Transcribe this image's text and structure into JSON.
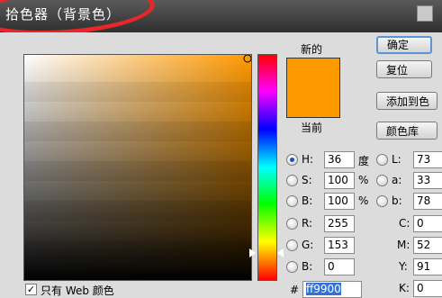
{
  "title": "拾色器（背景色）",
  "labels": {
    "new": "新的",
    "current": "当前"
  },
  "buttons": {
    "ok": "确定",
    "reset": "复位",
    "add_to_swatches": "添加到色",
    "color_libraries": "颜色库"
  },
  "hsb": {
    "h": {
      "label": "H:",
      "value": "36",
      "unit": "度"
    },
    "s": {
      "label": "S:",
      "value": "100",
      "unit": "%"
    },
    "b": {
      "label": "B:",
      "value": "100",
      "unit": "%"
    }
  },
  "rgb": {
    "r": {
      "label": "R:",
      "value": "255"
    },
    "g": {
      "label": "G:",
      "value": "153"
    },
    "b": {
      "label": "B:",
      "value": "0"
    }
  },
  "lab": {
    "l": {
      "label": "L:",
      "value": "73"
    },
    "a": {
      "label": "a:",
      "value": "33"
    },
    "b": {
      "label": "b:",
      "value": "78"
    }
  },
  "cmyk": {
    "c": {
      "label": "C:",
      "value": "0"
    },
    "m": {
      "label": "M:",
      "value": "52"
    },
    "y": {
      "label": "Y:",
      "value": "91"
    },
    "k": {
      "label": "K:",
      "value": "0"
    }
  },
  "hex": {
    "label": "#",
    "value": "ff9900"
  },
  "web_only": {
    "label": "只有 Web 颜色",
    "checked": true
  },
  "colors": {
    "selected": "#ff9900",
    "accent": "#3172d5",
    "annotation": "#e8262b"
  }
}
